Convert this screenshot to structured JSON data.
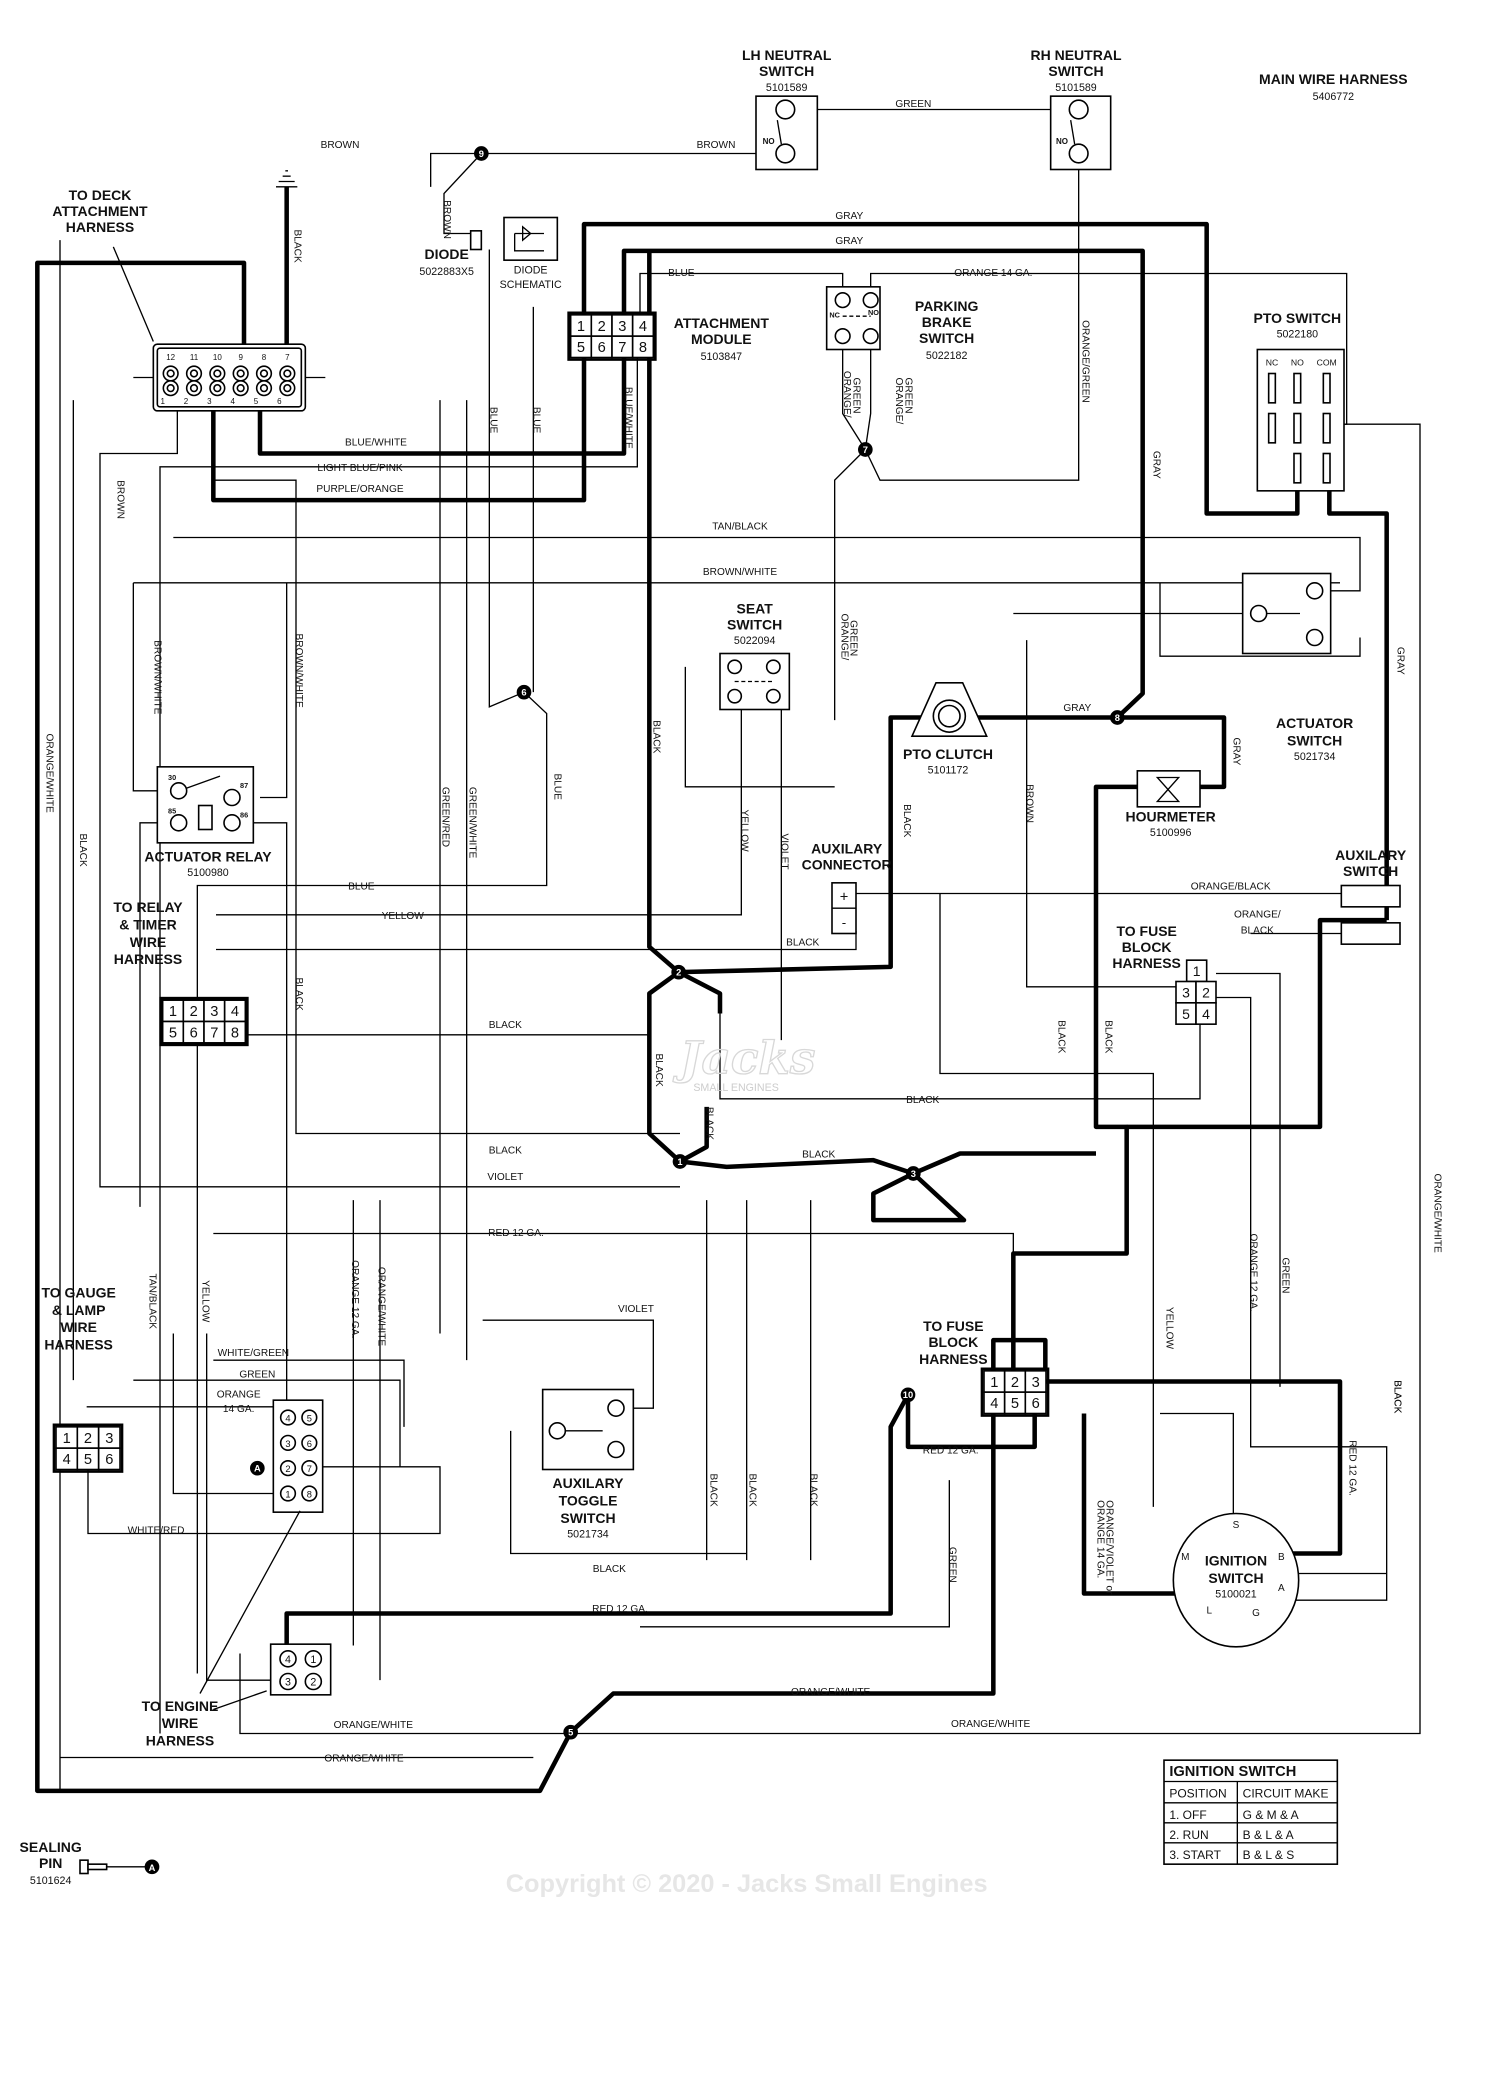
{
  "harness": {
    "title": "MAIN WIRE HARNESS",
    "part": "5406772"
  },
  "components": {
    "lh_neutral": {
      "title": [
        "LH NEUTRAL",
        "SWITCH"
      ],
      "part": "5101589",
      "contact": "NO"
    },
    "rh_neutral": {
      "title": [
        "RH NEUTRAL",
        "SWITCH"
      ],
      "part": "5101589",
      "contact": "NO"
    },
    "deck_harness": {
      "title": [
        "TO DECK",
        "ATTACHMENT",
        "HARNESS"
      ],
      "pins_top": [
        "12",
        "11",
        "10",
        "9",
        "8",
        "7"
      ],
      "pins_bottom": [
        "1",
        "2",
        "3",
        "4",
        "5",
        "6"
      ]
    },
    "diode": {
      "title": "DIODE",
      "part": "5022883X5"
    },
    "diode_schematic": {
      "title": [
        "DIODE",
        "SCHEMATIC"
      ]
    },
    "attachment_module": {
      "title": [
        "ATTACHMENT",
        "MODULE"
      ],
      "part": "5103847",
      "pins": [
        "1",
        "2",
        "3",
        "4",
        "5",
        "6",
        "7",
        "8"
      ]
    },
    "parking_brake": {
      "title": [
        "PARKING",
        "BRAKE",
        "SWITCH"
      ],
      "part": "5022182",
      "nc": "NC",
      "no": "NO"
    },
    "pto_switch": {
      "title": "PTO SWITCH",
      "part": "5022180",
      "cols": [
        "NC",
        "NO",
        "COM"
      ]
    },
    "seat_switch": {
      "title": [
        "SEAT",
        "SWITCH"
      ],
      "part": "5022094"
    },
    "pto_clutch": {
      "title": "PTO CLUTCH",
      "part": "5101172"
    },
    "actuator_switch": {
      "title": [
        "ACTUATOR",
        "SWITCH"
      ],
      "part": "5021734"
    },
    "hourmeter": {
      "title": "HOURMETER",
      "part": "5100996"
    },
    "aux_connector": {
      "title": [
        "AUXILARY",
        "CONNECTOR"
      ],
      "plus": "+",
      "minus": "-"
    },
    "aux_switch": {
      "title": [
        "AUXILARY",
        "SWITCH"
      ]
    },
    "fuse_block_upper": {
      "title": [
        "TO FUSE",
        "BLOCK",
        "HARNESS"
      ],
      "pins": [
        "1",
        "3",
        "2",
        "5",
        "4"
      ]
    },
    "actuator_relay": {
      "title": "ACTUATOR RELAY",
      "part": "5100980",
      "terminals": [
        "30",
        "87",
        "85",
        "86"
      ]
    },
    "relay_timer": {
      "title": [
        "TO RELAY",
        "& TIMER",
        "WIRE",
        "HARNESS"
      ],
      "pins": [
        "1",
        "2",
        "3",
        "4",
        "5",
        "6",
        "7",
        "8"
      ]
    },
    "gauge_lamp": {
      "title": [
        "TO GAUGE",
        "& LAMP",
        "WIRE",
        "HARNESS"
      ],
      "pins": [
        "1",
        "2",
        "3",
        "4",
        "5",
        "6"
      ],
      "plug_pins": [
        "4",
        "5",
        "3",
        "6",
        "2",
        "7",
        "1",
        "8"
      ]
    },
    "fuse_block_lower": {
      "title": [
        "TO FUSE",
        "BLOCK",
        "HARNESS"
      ],
      "pins": [
        "1",
        "2",
        "3",
        "4",
        "5",
        "6"
      ]
    },
    "aux_toggle": {
      "title": [
        "AUXILARY",
        "TOGGLE",
        "SWITCH"
      ],
      "part": "5021734"
    },
    "ignition": {
      "title": [
        "IGNITION",
        "SWITCH"
      ],
      "part": "5100021",
      "terminals": [
        "S",
        "M",
        "B",
        "A",
        "L",
        "G"
      ]
    },
    "engine_harness": {
      "title": [
        "TO ENGINE",
        "WIRE",
        "HARNESS"
      ],
      "pins": [
        "4",
        "1",
        "3",
        "2"
      ]
    },
    "sealing_pin": {
      "title": [
        "SEALING",
        "PIN"
      ],
      "part": "5101624",
      "marker": "A"
    }
  },
  "splices": [
    "9",
    "7",
    "6",
    "8",
    "2",
    "1",
    "3",
    "10",
    "5",
    "A"
  ],
  "wire_labels": [
    "BROWN",
    "BROWN",
    "GREEN",
    "GRAY",
    "GRAY",
    "ORANGE 14 GA.",
    "BLUE",
    "BLACK",
    "BROWN",
    "BLUE/WHITE",
    "LIGHT BLUE/PINK",
    "PURPLE/ORANGE",
    "BLUE",
    "BLUE",
    "BLUE/WHITE",
    "ORANGE/",
    "GREEN",
    "ORANGE/",
    "GREEN",
    "ORANGE/GREEN",
    "GRAY",
    "TAN/BLACK",
    "BROWN/WHITE",
    "BROWN",
    "BROWN/WHITE",
    "BROWN/WHITE",
    "ORANGE/",
    "GREEN",
    "BLACK",
    "GRAY",
    "GRAY",
    "GRAY",
    "ORANGE/WHITE",
    "BLACK",
    "GREEN/RED",
    "GREEN/WHITE",
    "BLUE",
    "YELLOW",
    "VIOLET",
    "BLACK",
    "BROWN",
    "BLUE",
    "YELLOW",
    "ORANGE/BLACK",
    "ORANGE/",
    "BLACK",
    "BLACK",
    "BLACK",
    "BLACK",
    "BLACK",
    "BLACK",
    "BLACK",
    "VIOLET",
    "BLACK",
    "BLACK",
    "BLACK",
    "BLACK",
    "BLACK",
    "RED 12 GA.",
    "ORANGE/WHITE",
    "ORANGE 12 GA.",
    "GREEN",
    "YELLOW",
    "BLACK",
    "TAN/BLACK",
    "YELLOW",
    "ORANGE 12 GA.",
    "ORANGE/WHITE",
    "VIOLET",
    "WHITE/GREEN",
    "GREEN",
    "ORANGE",
    "14 GA.",
    "WHITE/RED",
    "RED 12 GA.",
    "RED 12 GA.",
    "ORANGE/VIOLET or",
    "ORANGE 14 GA.",
    "BLACK",
    "BLACK",
    "BLACK",
    "GREEN",
    "BLACK",
    "RED 12 GA.",
    "ORANGE/WHITE",
    "ORANGE/WHITE",
    "ORANGE/WHITE",
    "ORANGE/WHITE"
  ],
  "ignition_table": {
    "title": "IGNITION SWITCH",
    "headers": [
      "POSITION",
      "CIRCUIT MAKE"
    ],
    "rows": [
      [
        "1. OFF",
        "G & M & A"
      ],
      [
        "2. RUN",
        "B & L & A"
      ],
      [
        "3. START",
        "B & L & S"
      ]
    ]
  },
  "watermark": {
    "copyright": "Copyright © 2020 - Jacks Small Engines",
    "logo": "Jacks",
    "logo_sub": "SMALL ENGINES"
  }
}
